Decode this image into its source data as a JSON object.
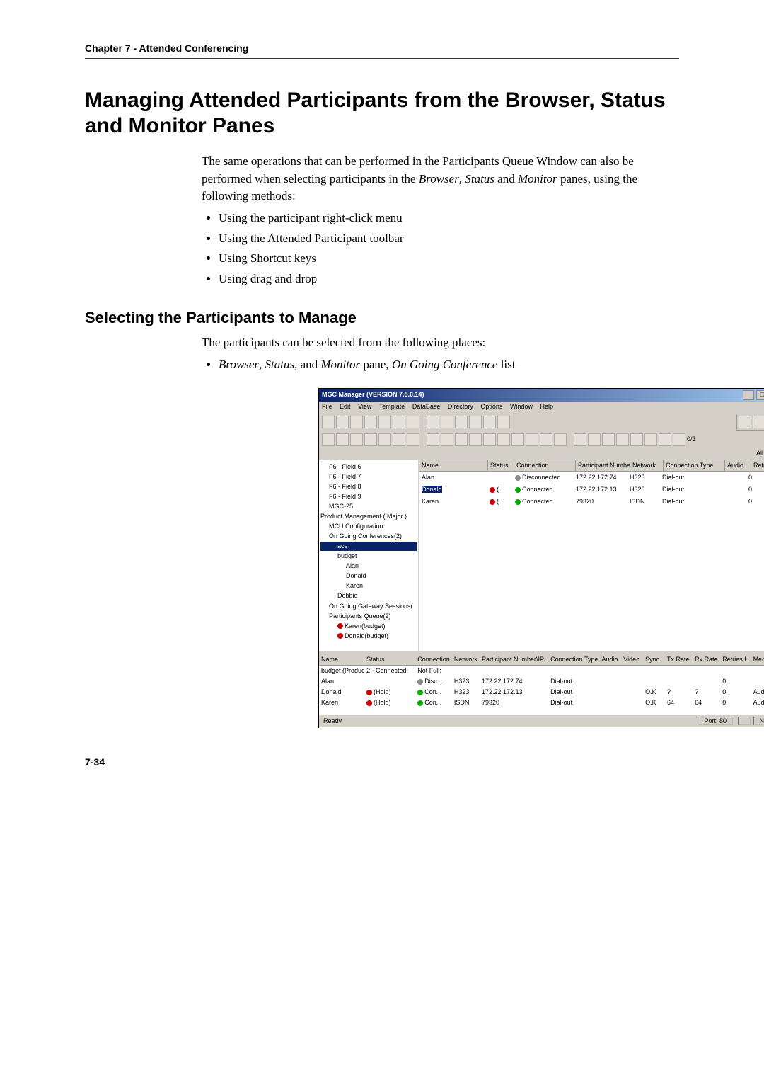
{
  "chapter": "Chapter 7 - Attended Conferencing",
  "heading": "Managing Attended Participants from the Browser, Status and Monitor Panes",
  "intro_part1": "The same operations that can be performed in the Participants Queue Window can also be performed when selecting participants in the ",
  "intro_browser": "Browser",
  "intro_sep1": ", ",
  "intro_status": "Status",
  "intro_sep2": " and ",
  "intro_monitor": "Monitor",
  "intro_part2": " panes, using the following methods:",
  "bullets": {
    "b1": "Using the participant right-click menu",
    "b2": "Using the Attended Participant toolbar",
    "b3": "Using Shortcut keys",
    "b4": "Using drag and drop"
  },
  "subheading": "Selecting the Participants to Manage",
  "sub_intro": "The participants can be selected from the following places:",
  "sub_bullet_prefix_b": "Browser",
  "sub_bullet_sep1": ", ",
  "sub_bullet_s": "Status",
  "sub_bullet_sep2": ", and ",
  "sub_bullet_m": "Monitor",
  "sub_bullet_mid": " pane, ",
  "sub_bullet_o": "On Going Conference",
  "sub_bullet_end": " list",
  "app": {
    "title": "MGC Manager (VERSION 7.5.0.14)",
    "menus": {
      "m1": "File",
      "m2": "Edit",
      "m3": "View",
      "m4": "Template",
      "m5": "DataBase",
      "m6": "Directory",
      "m7": "Options",
      "m8": "Window",
      "m9": "Help"
    },
    "filter_all": "All",
    "counter": "0/3",
    "tree": {
      "f6": "F6 - Field 6",
      "f7": "F6 - Field 7",
      "f8": "F6 - Field 8",
      "f9": "F6 - Field 9",
      "mgc": "MGC-25",
      "pm": "Product Management   ( Major )",
      "mcu": "MCU Configuration",
      "ogc": "On Going Conferences(2)",
      "ace": "ace",
      "budget": "budget",
      "alan": "Alan",
      "donald": "Donald",
      "karen": "Karen",
      "debbie": "Debbie",
      "ogs": "On Going Gateway Sessions(",
      "pq": "Participants Queue(2)",
      "kb": "Karen(budget)",
      "db": "Donald(budget)"
    },
    "list_headers": {
      "name": "Name",
      "status": "Status",
      "conn": "Connection",
      "part": "Participant Number\\...",
      "net": "Network",
      "ctype": "Connection Type",
      "audio": "Audio",
      "retries": "Retrie"
    },
    "list_rows": {
      "r1": {
        "name": "Alan",
        "status": "",
        "conn": "Disconnected",
        "part": "172.22.172.74",
        "net": "H323",
        "ctype": "Dial-out",
        "audio": "",
        "retries": "0"
      },
      "r2": {
        "name": "Donald",
        "status": "(...",
        "conn": "Connected",
        "part": "172.22.172.13",
        "net": "H323",
        "ctype": "Dial-out",
        "audio": "",
        "retries": "0"
      },
      "r3": {
        "name": "Karen",
        "status": "(...",
        "conn": "Connected",
        "part": "79320",
        "net": "ISDN",
        "ctype": "Dial-out",
        "audio": "",
        "retries": "0"
      }
    },
    "status_headers": {
      "name": "Name",
      "status": "Status",
      "conn": "Connection",
      "net": "Network",
      "part": "Participant Number\\IP ...",
      "ctype": "Connection Type",
      "audio": "Audio",
      "video": "Video",
      "sync": "Sync",
      "tx": "Tx Rate",
      "rx": "Rx Rate",
      "retl": "Retries L...",
      "media": "Media Mo"
    },
    "status_rows": {
      "s0": {
        "name": "budget (Produc...",
        "status": "2 - Connected;",
        "conn": "Not Full;",
        "net": "",
        "part": "",
        "ctype": "",
        "audio": "",
        "video": "",
        "sync": "",
        "tx": "",
        "rx": "",
        "retl": "",
        "media": ""
      },
      "s1": {
        "name": "Alan",
        "status": "",
        "conn": "Disc...",
        "net": "H323",
        "part": "172.22.172.74",
        "ctype": "Dial-out",
        "audio": "",
        "video": "",
        "sync": "",
        "tx": "",
        "rx": "",
        "retl": "0",
        "media": ""
      },
      "s2": {
        "name": "Donald",
        "status": "(Hold)",
        "conn": "Con...",
        "net": "H323",
        "part": "172.22.172.13",
        "ctype": "Dial-out",
        "audio": "",
        "video": "",
        "sync": "O.K",
        "tx": "?",
        "rx": "?",
        "retl": "0",
        "media": "Audio;"
      },
      "s3": {
        "name": "Karen",
        "status": "(Hold)",
        "conn": "Con...",
        "net": "ISDN",
        "part": "79320",
        "ctype": "Dial-out",
        "audio": "",
        "video": "",
        "sync": "O.K",
        "tx": "64",
        "rx": "64",
        "retl": "0",
        "media": "Audio;"
      }
    },
    "statusbar": {
      "ready": "Ready",
      "port": "Port: 80",
      "num": "NUM"
    }
  },
  "page_number": "7-34"
}
